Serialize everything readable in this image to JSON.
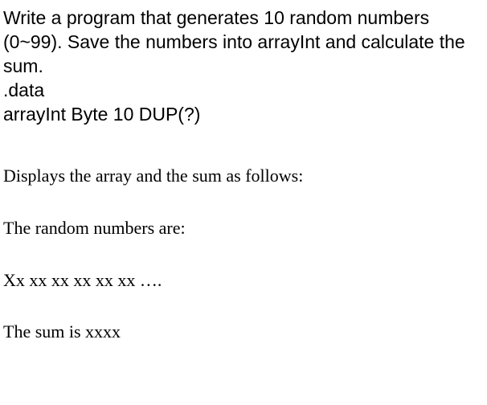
{
  "problem": {
    "line1": "Write a program that generates 10 random numbers (0~99). Save the numbers into arrayInt  and calculate the sum.",
    "line2": ".data",
    "line3": "arrayInt Byte 10  DUP(?)"
  },
  "output": {
    "line1": "Displays the array and the sum as follows:",
    "line2": "The random numbers are:",
    "line3": "Xx xx xx xx xx xx ….",
    "line4": "The sum is   xxxx"
  }
}
